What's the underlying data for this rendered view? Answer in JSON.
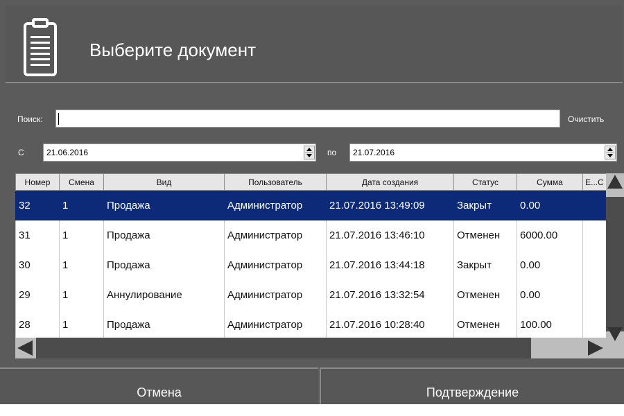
{
  "header": {
    "title": "Выберите документ",
    "icon": "clipboard-icon"
  },
  "search": {
    "label": "Поиск:",
    "value": "",
    "clear_label": "Очистить"
  },
  "dates": {
    "from_label": "С",
    "from_value": "21.06.2016",
    "to_label": "по",
    "to_value": "21.07.2016"
  },
  "table": {
    "columns": [
      "Номер",
      "Смена",
      "Вид",
      "Пользователь",
      "Дата создания",
      "Статус",
      "Сумма",
      "Е...С"
    ],
    "rows": [
      [
        "32",
        "1",
        "Продажа",
        "Администратор",
        "21.07.2016 13:49:09",
        "Закрыт",
        "0.00",
        ""
      ],
      [
        "31",
        "1",
        "Продажа",
        "Администратор",
        "21.07.2016 13:46:10",
        "Отменен",
        "6000.00",
        ""
      ],
      [
        "30",
        "1",
        "Продажа",
        "Администратор",
        "21.07.2016 13:44:18",
        "Закрыт",
        "0.00",
        ""
      ],
      [
        "29",
        "1",
        "Аннулирование",
        "Администратор",
        "21.07.2016 13:32:54",
        "Отменен",
        "0.00",
        ""
      ],
      [
        "28",
        "1",
        "Продажа",
        "Администратор",
        "21.07.2016 10:28:40",
        "Отменен",
        "100.00",
        ""
      ]
    ],
    "selected_row": 0
  },
  "footer": {
    "cancel_label": "Отмена",
    "confirm_label": "Подтверждение"
  },
  "colors": {
    "background": "#5b5b5b",
    "selection": "#0c2a78",
    "text_light": "#ffffff"
  }
}
